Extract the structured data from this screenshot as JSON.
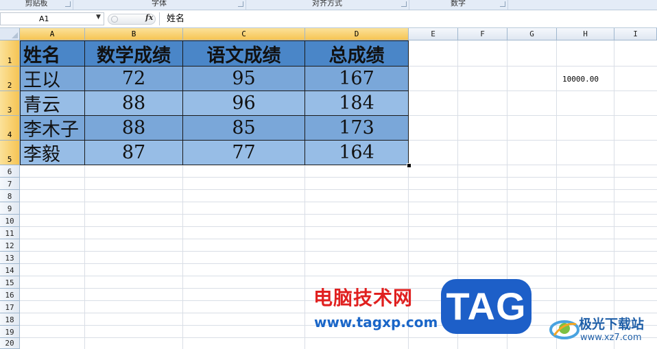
{
  "ribbon": {
    "groups": [
      {
        "label": "剪贴板"
      },
      {
        "label": "字体"
      },
      {
        "label": "对齐方式"
      },
      {
        "label": "数字"
      }
    ]
  },
  "formula_bar": {
    "name_box": "A1",
    "fx_icon": "fx",
    "content": "姓名"
  },
  "columns": [
    "A",
    "B",
    "C",
    "D",
    "E",
    "F",
    "G",
    "H",
    "I"
  ],
  "rows": [
    "1",
    "2",
    "3",
    "4",
    "5",
    "6",
    "7",
    "8",
    "9",
    "10",
    "11",
    "12",
    "13",
    "14",
    "15",
    "16",
    "17",
    "18",
    "19",
    "20"
  ],
  "table": {
    "headers": [
      "姓名",
      "数学成绩",
      "语文成绩",
      "总成绩"
    ],
    "rows": [
      [
        "王以",
        "72",
        "95",
        "167"
      ],
      [
        "青云",
        "88",
        "96",
        "184"
      ],
      [
        "李木子",
        "88",
        "85",
        "173"
      ],
      [
        "李毅",
        "87",
        "77",
        "164"
      ]
    ]
  },
  "extra_cell": {
    "ref": "H2",
    "value": "10000.00"
  },
  "watermark": {
    "site_cn": "电脑技术网",
    "site_url": "www.tagxp.com",
    "tag": "TAG",
    "xz_cn": "极光下载站",
    "xz_url": "www.xz7.com"
  },
  "colors": {
    "header_fill": "#4a86c8",
    "row_fill_dark": "#7aa7d9",
    "row_fill_light": "#97bde6",
    "selected_header": "#f6c453"
  }
}
